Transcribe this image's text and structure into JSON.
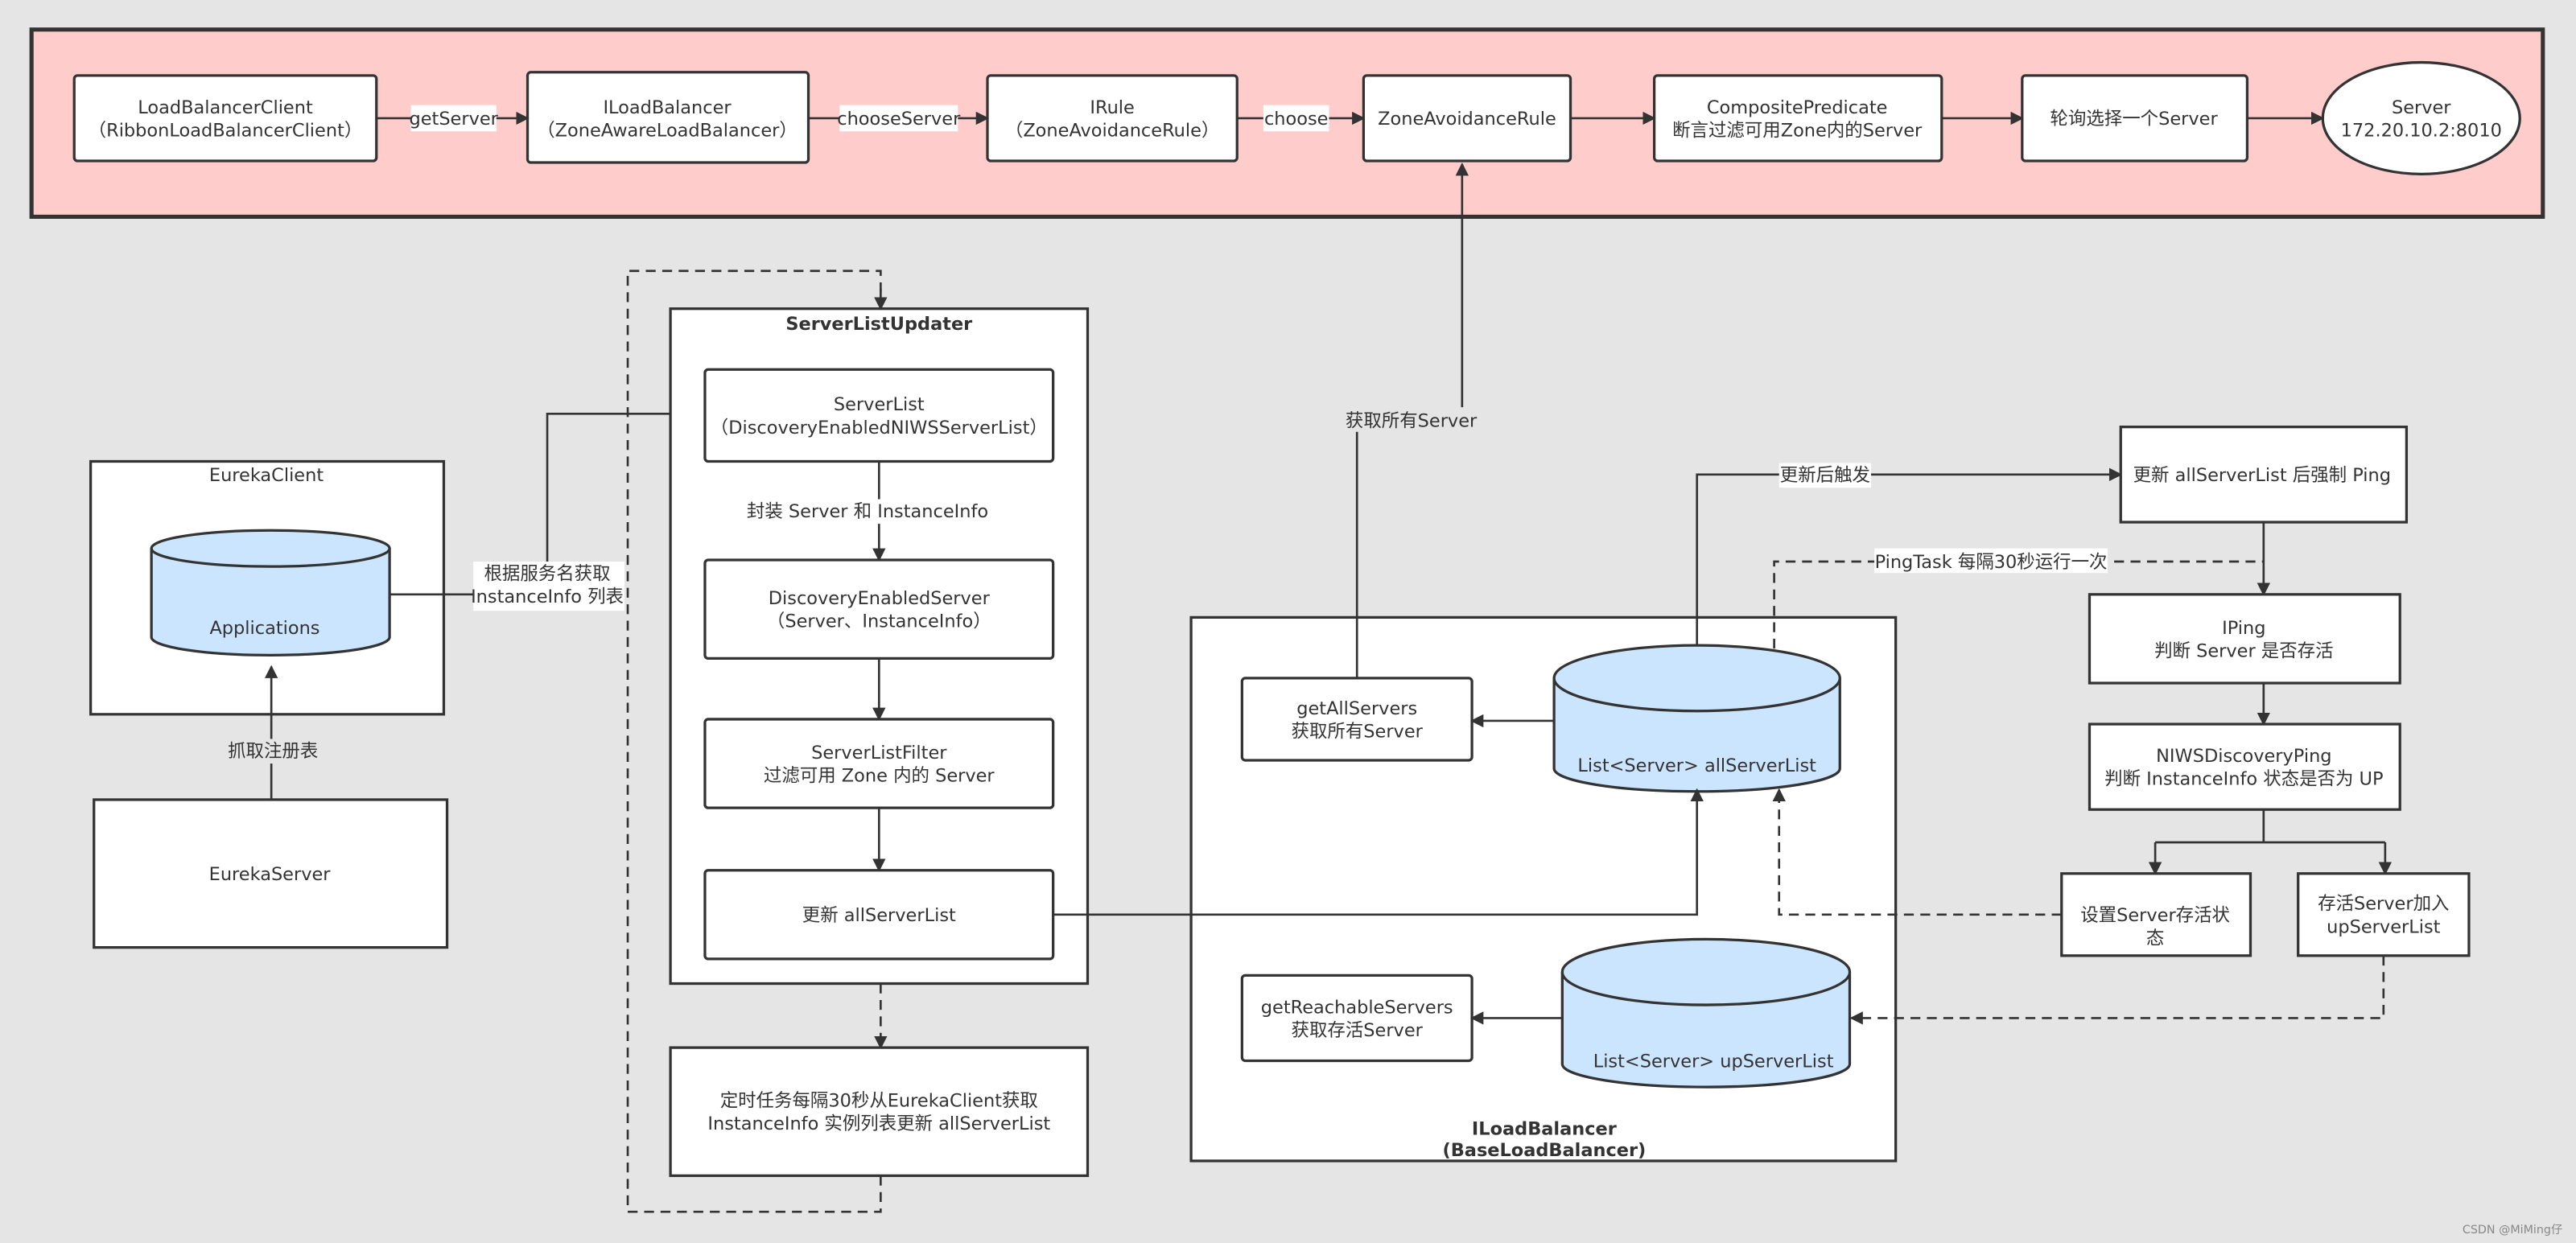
{
  "colors": {
    "background": "#e5e5e5",
    "top_band": "#ffcccc",
    "database": "#cce5ff",
    "stroke": "#333333"
  },
  "top_flow": {
    "load_balancer_client": [
      "LoadBalancerClient",
      "（RibbonLoadBalancerClient）"
    ],
    "iloadbalancer": [
      "ILoadBalancer",
      "（ZoneAwareLoadBalancer）"
    ],
    "irule": [
      "IRule",
      "（ZoneAvoidanceRule）"
    ],
    "zone_avoidance_rule": "ZoneAvoidanceRule",
    "composite_predicate": [
      "CompositePredicate",
      "断言过滤可用Zone内的Server"
    ],
    "round_robin": "轮询选择一个Server",
    "server": [
      "Server",
      "172.20.10.2:8010"
    ],
    "edge_get_server": "getServer",
    "edge_choose_server": "chooseServer",
    "edge_choose": "choose"
  },
  "eureka": {
    "client_title": "EurekaClient",
    "applications": "Applications",
    "server": "EurekaServer",
    "fetch_label": "抓取注册表",
    "by_service_label": [
      "根据服务名获取",
      "InstanceInfo 列表"
    ]
  },
  "updater": {
    "title": "ServerListUpdater",
    "server_list": [
      "ServerList",
      "（DiscoveryEnabledNIWSServerList）"
    ],
    "wrap_label": "封装 Server 和 InstanceInfo",
    "discovery_server": [
      "DiscoveryEnabledServer",
      "（Server、InstanceInfo）"
    ],
    "filter": [
      "ServerListFilter",
      "过滤可用 Zone 内的 Server"
    ],
    "update": "更新 allServerList",
    "timer": [
      "定时任务每隔30秒从EurekaClient获取",
      "InstanceInfo 实例列表更新 allServerList"
    ]
  },
  "base_lb": {
    "title": [
      "ILoadBalancer",
      "(BaseLoadBalancer)"
    ],
    "get_all": [
      "getAllServers",
      "获取所有Server"
    ],
    "all_list": "List<Server> allServerList",
    "get_reachable": [
      "getReachableServers",
      "获取存活Server"
    ],
    "up_list": "List<Server> upServerList",
    "get_all_label": "获取所有Server"
  },
  "ping": {
    "trigger_label": "更新后触发",
    "force_ping": "更新 allServerList 后强制 Ping",
    "ping_task_label": "PingTask 每隔30秒运行一次",
    "iping": [
      "IPing",
      "判断 Server 是否存活"
    ],
    "niws_ping": [
      "NIWSDiscoveryPing",
      "判断 InstanceInfo 状态是否为 UP"
    ],
    "set_alive": [
      "设置Server存活状",
      "态"
    ],
    "add_up": [
      "存活Server加入",
      "upServerList"
    ]
  },
  "watermark": "CSDN @MiMing仔"
}
